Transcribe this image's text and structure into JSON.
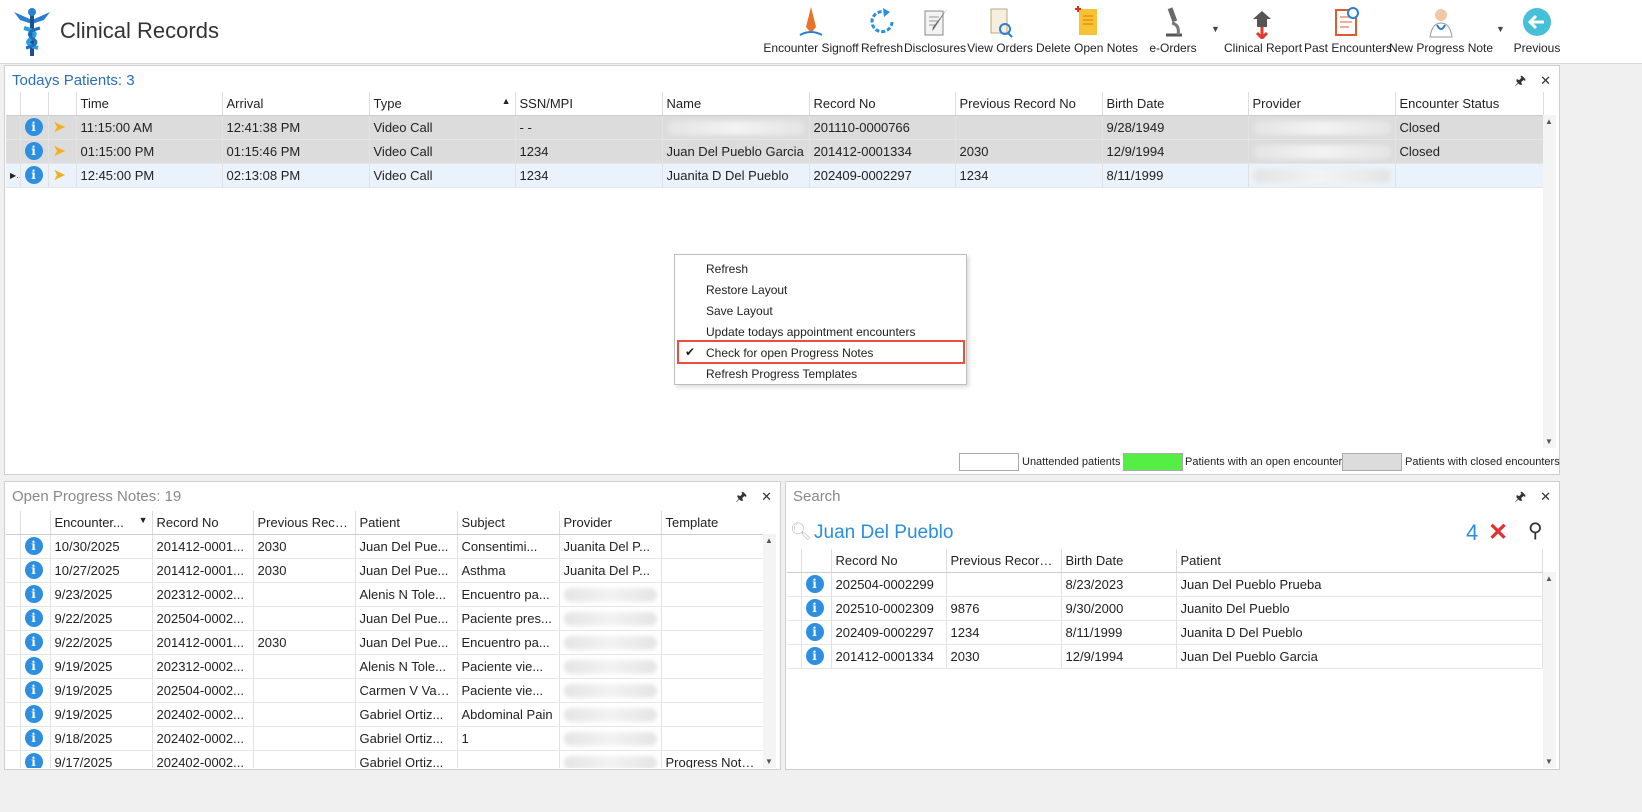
{
  "app": {
    "title": "Clinical Records"
  },
  "toolbar": [
    {
      "label": "Encounter Signoff",
      "icon": "signoff-pen-icon"
    },
    {
      "label": "Refresh",
      "icon": "refresh-icon"
    },
    {
      "label": "Disclosures",
      "icon": "disclosures-icon"
    },
    {
      "label": "View Orders",
      "icon": "view-orders-icon"
    },
    {
      "label": "Delete Open Notes",
      "icon": "delete-notes-icon"
    },
    {
      "label": "e-Orders",
      "icon": "microscope-icon"
    },
    {
      "label": "Clinical Report",
      "icon": "clinical-report-icon"
    },
    {
      "label": "Past Encounters",
      "icon": "past-encounters-icon"
    },
    {
      "label": "New Progress Note",
      "icon": "doctor-icon"
    },
    {
      "label": "Previous",
      "icon": "back-arrow-icon"
    }
  ],
  "todays_patients": {
    "title": "Todays Patients:",
    "count": "3",
    "columns": [
      "Time",
      "Arrival",
      "Type",
      "SSN/MPI",
      "Name",
      "Record No",
      "Previous Record No",
      "Birth Date",
      "Provider",
      "Encounter Status"
    ],
    "rows": [
      {
        "time": "11:15:00 AM",
        "arrival": "12:41:38 PM",
        "type": "Video Call",
        "ssn": "-  -",
        "name": "",
        "record": "201110-0000766",
        "prev": "",
        "birth": "9/28/1949",
        "status": "Closed"
      },
      {
        "time": "01:15:00 PM",
        "arrival": "01:15:46 PM",
        "type": "Video Call",
        "ssn": "1234",
        "name": "Juan Del Pueblo Garcia",
        "record": "201412-0001334",
        "prev": "2030",
        "birth": "12/9/1994",
        "status": "Closed"
      },
      {
        "time": "12:45:00 PM",
        "arrival": "02:13:08 PM",
        "type": "Video Call",
        "ssn": "1234",
        "name": "Juanita D Del Pueblo",
        "record": "202409-0002297",
        "prev": "1234",
        "birth": "8/11/1999",
        "status": ""
      }
    ]
  },
  "context_menu": {
    "items": [
      "Refresh",
      "Restore Layout",
      "Save Layout",
      "Update todays appointment encounters",
      "Check for open Progress Notes",
      "Refresh Progress Templates"
    ],
    "checked": "Check for open Progress Notes"
  },
  "legend": {
    "unattended": "Unattended patients",
    "open": "Patients with an open encounter",
    "closed": "Patients with closed encounters",
    "colors": {
      "unattended": "#ffffff",
      "open": "#55ee44",
      "closed": "#dcdcdc"
    }
  },
  "open_notes": {
    "title": "Open Progress Notes:",
    "count": "19",
    "columns": [
      "Encounter...",
      "Record No",
      "Previous Reco...",
      "Patient",
      "Subject",
      "Provider",
      "Template"
    ],
    "rows": [
      {
        "date": "10/30/2025",
        "record": "201412-0001...",
        "prev": "2030",
        "patient": "Juan Del Pue...",
        "subject": "Consentimi...",
        "provider": "Juanita Del P...",
        "template": ""
      },
      {
        "date": "10/27/2025",
        "record": "201412-0001...",
        "prev": "2030",
        "patient": "Juan Del Pue...",
        "subject": "Asthma",
        "provider": "Juanita Del P...",
        "template": ""
      },
      {
        "date": "9/23/2025",
        "record": "202312-0002...",
        "prev": "",
        "patient": "Alenis N Tole...",
        "subject": "Encuentro pa...",
        "provider": "",
        "template": ""
      },
      {
        "date": "9/22/2025",
        "record": "202504-0002...",
        "prev": "",
        "patient": "Juan Del Pue...",
        "subject": "Paciente pres...",
        "provider": "",
        "template": ""
      },
      {
        "date": "9/22/2025",
        "record": "201412-0001...",
        "prev": "2030",
        "patient": "Juan Del Pue...",
        "subject": "Encuentro pa...",
        "provider": "",
        "template": ""
      },
      {
        "date": "9/19/2025",
        "record": "202312-0002...",
        "prev": "",
        "patient": "Alenis N Tole...",
        "subject": "Paciente vie...",
        "provider": "",
        "template": ""
      },
      {
        "date": "9/19/2025",
        "record": "202504-0002...",
        "prev": "",
        "patient": "Carmen V Vaz...",
        "subject": "Paciente vie...",
        "provider": "",
        "template": ""
      },
      {
        "date": "9/19/2025",
        "record": "202402-0002...",
        "prev": "",
        "patient": "Gabriel Ortiz...",
        "subject": "Abdominal Pain",
        "provider": "",
        "template": ""
      },
      {
        "date": "9/18/2025",
        "record": "202402-0002...",
        "prev": "",
        "patient": "Gabriel Ortiz...",
        "subject": "1",
        "provider": "",
        "template": ""
      },
      {
        "date": "9/17/2025",
        "record": "202402-0002...",
        "prev": "",
        "patient": "Gabriel Ortiz...",
        "subject": "",
        "provider": "",
        "template": "Progress Note..."
      }
    ]
  },
  "search": {
    "title": "Search",
    "query": "Juan Del Pueblo",
    "result_count": "4",
    "columns": [
      "Record No",
      "Previous Record...",
      "Birth Date",
      "Patient"
    ],
    "rows": [
      {
        "record": "202504-0002299",
        "prev": "",
        "birth": "8/23/2023",
        "patient": "Juan Del Pueblo Prueba"
      },
      {
        "record": "202510-0002309",
        "prev": "9876",
        "birth": "9/30/2000",
        "patient": "Juanito Del Pueblo"
      },
      {
        "record": "202409-0002297",
        "prev": "1234",
        "birth": "8/11/1999",
        "patient": "Juanita D Del Pueblo"
      },
      {
        "record": "201412-0001334",
        "prev": "2030",
        "birth": "12/9/1994",
        "patient": "Juan Del Pueblo Garcia"
      }
    ]
  }
}
